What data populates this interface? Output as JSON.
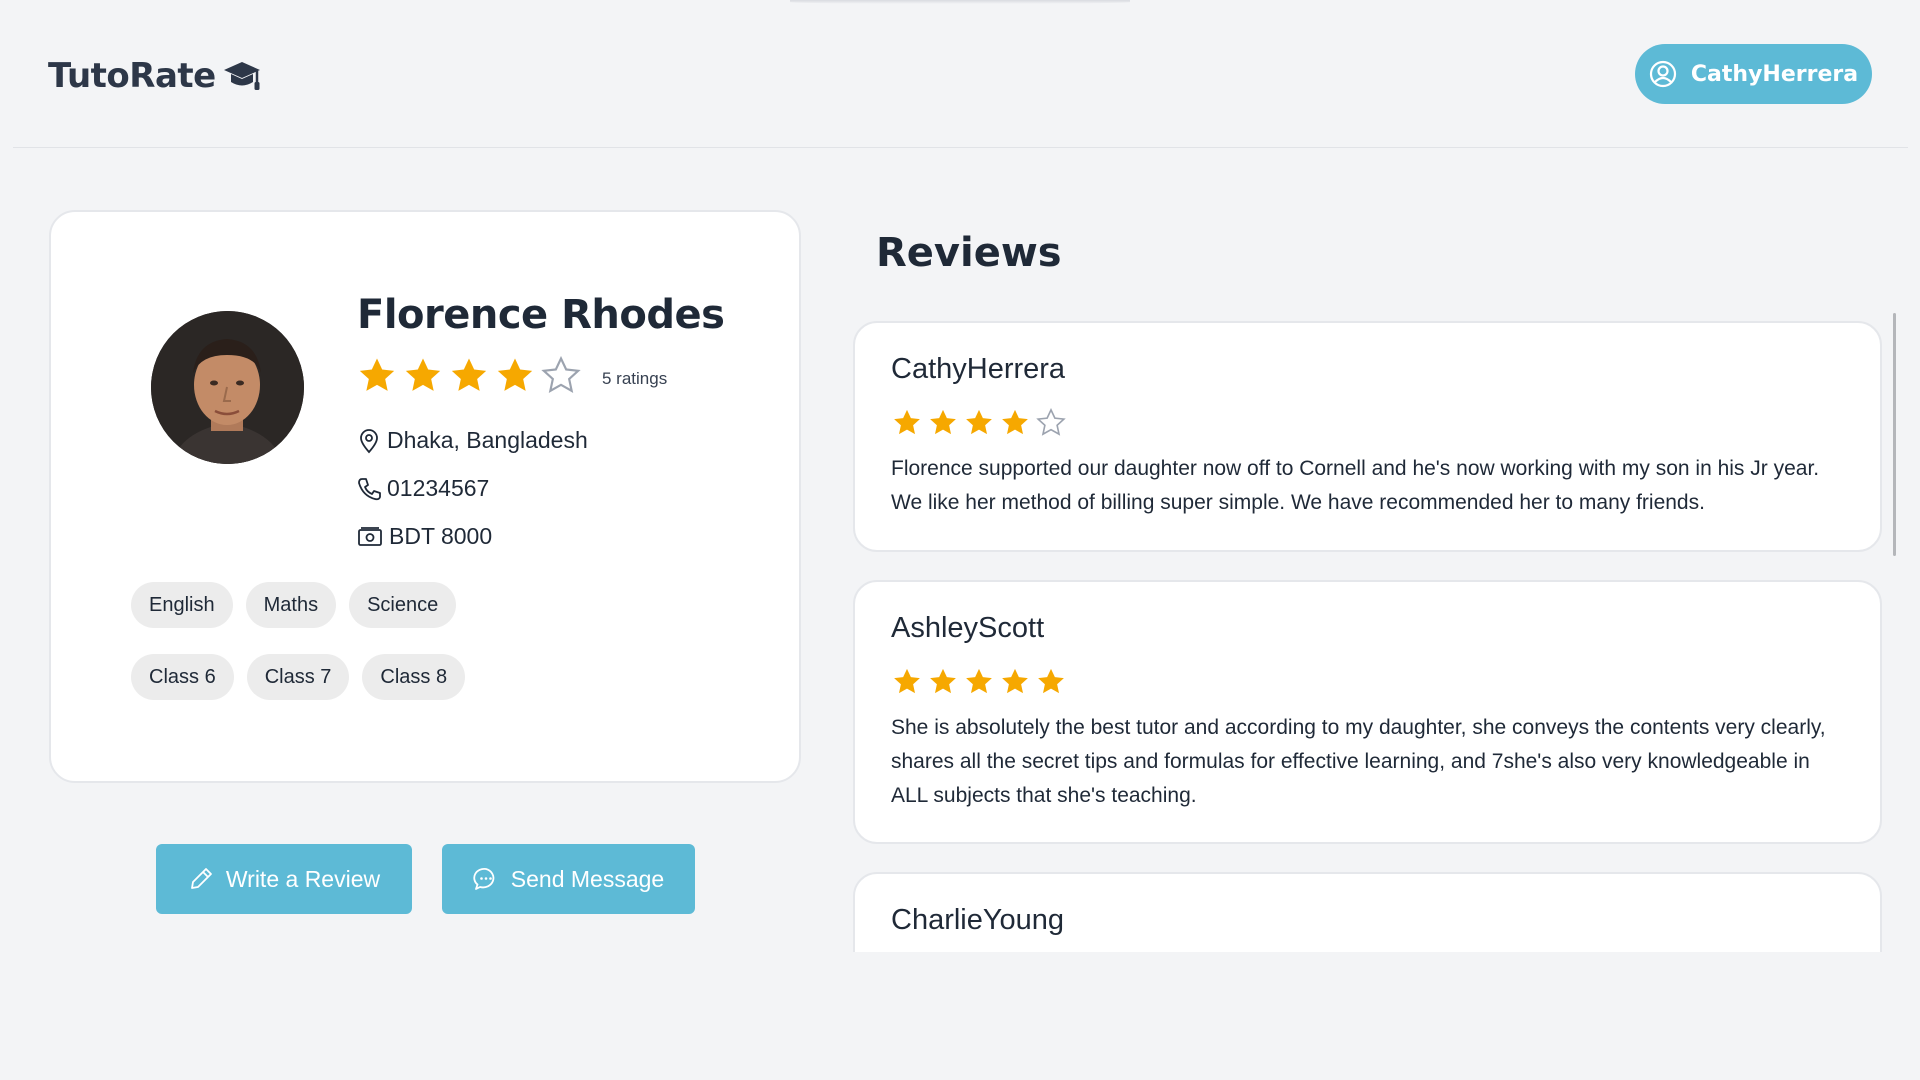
{
  "app": {
    "logo_text": "TutoRate",
    "logo_icon": "graduation-cap-icon",
    "accent_color": "#5dbad6",
    "star_color": "#f6a800"
  },
  "user": {
    "name": "CathyHerrera",
    "icon": "user-circle-icon"
  },
  "tutor": {
    "name": "Florence Rhodes",
    "rating": 4,
    "rating_max": 5,
    "ratings_count": "5 ratings",
    "location": "Dhaka, Bangladesh",
    "location_icon": "map-pin-icon",
    "phone": "01234567",
    "phone_icon": "phone-icon",
    "fee": "BDT 8000",
    "fee_icon": "banknote-icon",
    "subjects": [
      "English",
      "Maths",
      "Science"
    ],
    "classes": [
      "Class 6",
      "Class 7",
      "Class 8"
    ]
  },
  "actions": {
    "write_review": "Write a Review",
    "write_review_icon": "pencil-icon",
    "send_message": "Send Message",
    "send_message_icon": "chat-bubble-icon"
  },
  "reviews_section": {
    "title": "Reviews",
    "items": [
      {
        "author": "CathyHerrera",
        "rating": 4,
        "text": "Florence supported our daughter now off to Cornell and he's now working with my son in his Jr year. We like her method of billing super simple. We have recommended her to many friends."
      },
      {
        "author": "AshleyScott",
        "rating": 5,
        "text": "She is absolutely the best tutor and according to my daughter, she conveys the contents very clearly, shares all the secret tips and formulas for effective learning, and 7she's also very knowledgeable in ALL subjects that she's teaching."
      },
      {
        "author": "CharlieYoung",
        "rating": 0,
        "text": ""
      }
    ]
  }
}
